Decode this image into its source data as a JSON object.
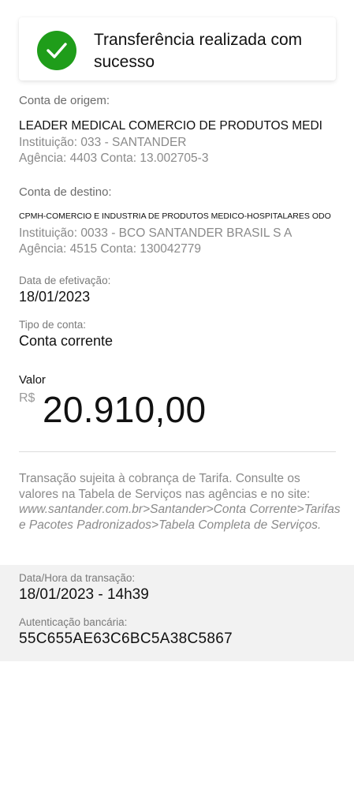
{
  "banner": {
    "title": "Transferência realizada com sucesso",
    "icon": "check-circle-icon",
    "accent_color": "#1f9d1a"
  },
  "origin": {
    "label": "Conta de origem:",
    "name": "LEADER MEDICAL COMERCIO DE PRODUTOS MEDI",
    "institution": "Instituição: 033 - SANTANDER",
    "agency_account": "Agência: 4403 Conta: 13.002705-3"
  },
  "destination": {
    "label": "Conta de destino:",
    "name": "CPMH-COMERCIO E INDUSTRIA DE PRODUTOS MEDICO-HOSPITALARES ODO",
    "institution": "Instituição: 0033 - BCO SANTANDER  BRASIL  S A",
    "agency_account": "Agência: 4515 Conta: 130042779"
  },
  "effective_date": {
    "label": "Data de efetivação:",
    "value": "18/01/2023"
  },
  "account_type": {
    "label": "Tipo de conta:",
    "value": "Conta corrente"
  },
  "amount": {
    "label": "Valor",
    "currency": "R$",
    "value": "20.910,00"
  },
  "fee_note": {
    "text": "Transação sujeita à cobrança de Tarifa. Consulte os valores na Tabela de Serviços nas agências e no site:",
    "link": "www.santander.com.br>Santander>Conta Corrente>Tarifas e Pacotes Padronizados>Tabela Completa de Serviços."
  },
  "transaction": {
    "datetime_label": "Data/Hora da transação:",
    "datetime_value": "18/01/2023 - 14h39",
    "auth_label": "Autenticação bancária:",
    "auth_value": "55C655AE63C6BC5A38C5867"
  }
}
